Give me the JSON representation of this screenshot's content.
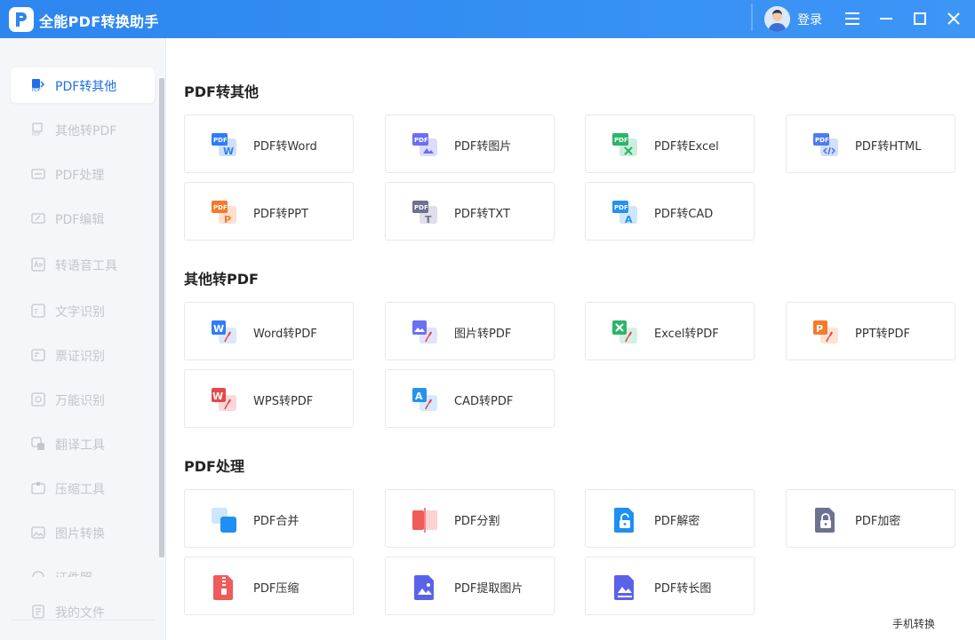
{
  "app": {
    "title": "全能PDF转换助手",
    "login_label": "登录"
  },
  "sidebar": {
    "items": [
      {
        "label": "PDF转其他",
        "icon": "pdf-to-other-icon"
      },
      {
        "label": "其他转PDF",
        "icon": "other-to-pdf-icon"
      },
      {
        "label": "PDF处理",
        "icon": "pdf-process-icon"
      },
      {
        "label": "PDF编辑",
        "icon": "pdf-edit-icon"
      },
      {
        "label": "转语音工具",
        "icon": "voice-icon"
      },
      {
        "label": "文字识别",
        "icon": "ocr-icon"
      },
      {
        "label": "票证识别",
        "icon": "ticket-icon"
      },
      {
        "label": "万能识别",
        "icon": "scan-icon"
      },
      {
        "label": "翻译工具",
        "icon": "translate-icon"
      },
      {
        "label": "压缩工具",
        "icon": "compress-icon"
      },
      {
        "label": "图片转换",
        "icon": "image-convert-icon"
      },
      {
        "label": "证件照",
        "icon": "id-photo-icon"
      }
    ],
    "my_files": "我的文件"
  },
  "sections": [
    {
      "title": "PDF转其他",
      "cards": [
        {
          "label": "PDF转Word",
          "icon": "pdf-word-icon",
          "color": "#2f7cf6"
        },
        {
          "label": "PDF转图片",
          "icon": "pdf-image-icon",
          "color": "#6b6ff2"
        },
        {
          "label": "PDF转Excel",
          "icon": "pdf-excel-icon",
          "color": "#2cb56a"
        },
        {
          "label": "PDF转HTML",
          "icon": "pdf-html-icon",
          "color": "#4e7de9"
        },
        {
          "label": "PDF转PPT",
          "icon": "pdf-ppt-icon",
          "color": "#f57a2b"
        },
        {
          "label": "PDF转TXT",
          "icon": "pdf-txt-icon",
          "color": "#6e7290"
        },
        {
          "label": "PDF转CAD",
          "icon": "pdf-cad-icon",
          "color": "#2592f0"
        }
      ]
    },
    {
      "title": "其他转PDF",
      "cards": [
        {
          "label": "Word转PDF",
          "icon": "word-pdf-icon",
          "color": "#2f7cf6"
        },
        {
          "label": "图片转PDF",
          "icon": "image-pdf-icon",
          "color": "#6b6ff2"
        },
        {
          "label": "Excel转PDF",
          "icon": "excel-pdf-icon",
          "color": "#2cb56a"
        },
        {
          "label": "PPT转PDF",
          "icon": "ppt-pdf-icon",
          "color": "#f57a2b"
        },
        {
          "label": "WPS转PDF",
          "icon": "wps-pdf-icon",
          "color": "#e8474a"
        },
        {
          "label": "CAD转PDF",
          "icon": "cad-pdf-icon",
          "color": "#2592f0"
        }
      ]
    },
    {
      "title": "PDF处理",
      "cards": [
        {
          "label": "PDF合并",
          "icon": "merge-icon",
          "color": "#1e8ff5"
        },
        {
          "label": "PDF分割",
          "icon": "split-icon",
          "color": "#f05a5a"
        },
        {
          "label": "PDF解密",
          "icon": "unlock-icon",
          "color": "#1e8ff5"
        },
        {
          "label": "PDF加密",
          "icon": "lock-icon",
          "color": "#6e7290"
        },
        {
          "label": "PDF压缩",
          "icon": "zip-icon",
          "color": "#f05a5a"
        },
        {
          "label": "PDF提取图片",
          "icon": "extract-image-icon",
          "color": "#5a63e8"
        },
        {
          "label": "PDF转长图",
          "icon": "long-image-icon",
          "color": "#5a63e8"
        }
      ]
    }
  ],
  "footer": {
    "mobile_label": "手机转换"
  }
}
